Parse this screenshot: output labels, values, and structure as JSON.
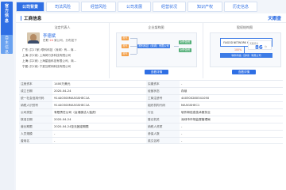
{
  "rail": {
    "tab1": "官方信息",
    "tab2": "自主信息"
  },
  "tabs": [
    {
      "label": "公司背景",
      "count": "",
      "active": true
    },
    {
      "label": "司法风险",
      "count": "",
      "active": false
    },
    {
      "label": "经营风险",
      "count": "",
      "active": false
    },
    {
      "label": "公司发展",
      "count": "",
      "active": false
    },
    {
      "label": "经营状况",
      "count": "",
      "active": false
    },
    {
      "label": "知识产权",
      "count": "",
      "active": false
    },
    {
      "label": "历史信息",
      "count": "",
      "active": false
    }
  ],
  "card": {
    "title": "工商信息",
    "logo": "天眼查"
  },
  "panel1": {
    "header": "法定代表人",
    "name": "李德斌",
    "meta_prefix": "任职",
    "meta_count": "24",
    "meta_suffix": "家公司，分布如下",
    "rows": [
      {
        "loc": "广东",
        "count": "(共17家)",
        "text": "联科科技（深圳）有... 商..."
      },
      {
        "loc": "上海",
        "count": "(共1家)",
        "text": "上海闵行多科技有限公司"
      },
      {
        "loc": "上海",
        "count": "(共2家)",
        "text": "上海星链科技有限公司、商..."
      },
      {
        "loc": "宁夏",
        "count": "(共1家)",
        "text": "宁夏互联网科技有限公司"
      }
    ]
  },
  "panel2": {
    "header": "企业架构图",
    "nodes": [
      "股东",
      "股东",
      "股东",
      "对外投资",
      "对外投资"
    ],
    "center": "联科科技（深圳）有限公司",
    "button": "查看详情"
  },
  "panel3": {
    "header": "股权结构图",
    "holder": "FAIGOD NETWORK HOLDING LIMITED",
    "pct": "100%",
    "company": "联科科技（深圳）有限公司",
    "button": "查看详情",
    "score_label": "天眼评分",
    "score": "86",
    "score_sub": "分"
  },
  "table": {
    "rows": [
      {
        "k1": "注册资本",
        "v1": "1400万美元",
        "k2": "实缴资本",
        "v2": "-"
      },
      {
        "k1": "成立日期",
        "v1": "2020-04-24",
        "k2": "经营状态",
        "v2": "存续"
      },
      {
        "k1": "统一社会信用代码",
        "v1": "91440300MA5GSHEC1A",
        "k2": "工商注册号",
        "v2": "440300280341050"
      },
      {
        "k1": "纳税人识别号",
        "v1": "91440300MA5GSHEC1A",
        "k2": "组织机构代码",
        "v2": "MA5GSHEC1"
      },
      {
        "k1": "公司类型",
        "v1": "有限责任公司（台港澳法人独资）",
        "k2": "行业",
        "v2": "软件和信息技术服务业"
      },
      {
        "k1": "核准日期",
        "v1": "2020-04-24",
        "k2": "登记机关",
        "v2": "深圳市市场监督管理局"
      },
      {
        "k1": "营业期限",
        "v1": "2020-04-24至无固定期限",
        "k2": "纳税人资质",
        "v2": "-"
      },
      {
        "k1": "人员规模",
        "v1": "-",
        "k2": "参保人数",
        "v2": "-"
      },
      {
        "k1": "曾用名",
        "v1": "-",
        "k2": "英文名称",
        "v2": "-"
      }
    ]
  }
}
